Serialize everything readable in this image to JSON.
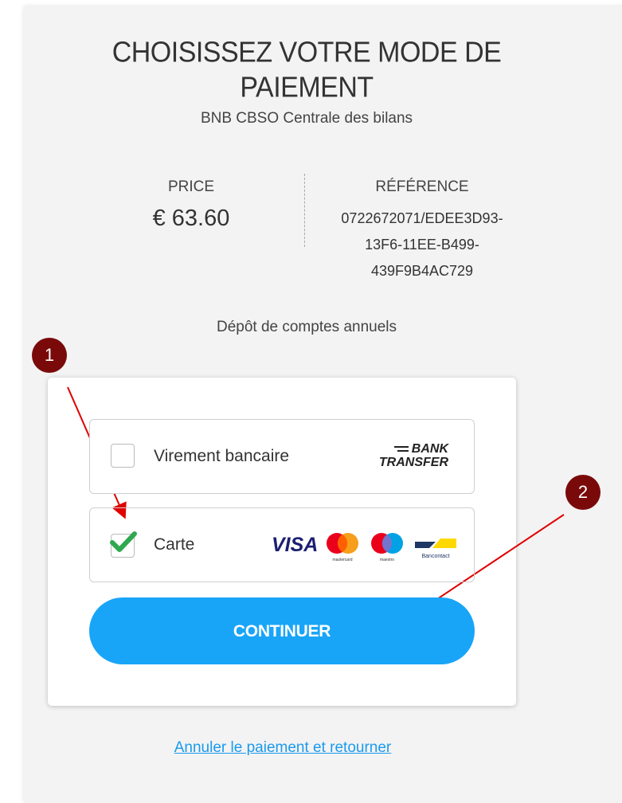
{
  "header": {
    "title_line1": "CHOISISSEZ VOTRE MODE DE",
    "title_line2": "PAIEMENT",
    "subtitle": "BNB CBSO Centrale des bilans"
  },
  "summary": {
    "price_label": "PRICE",
    "price_value": "€ 63.60",
    "reference_label": "RÉFÉRENCE",
    "reference_line1": "0722672071/EDEE3D93-",
    "reference_line2": "13F6-11EE-B499-",
    "reference_line3": "439F9B4AC729",
    "description": "Dépôt de comptes annuels"
  },
  "payment": {
    "options": [
      {
        "label": "Virement bancaire",
        "checked": false,
        "logo_line1": "BANK",
        "logo_line2": "TRANSFER"
      },
      {
        "label": "Carte",
        "checked": true,
        "logos": [
          "VISA",
          "mastercard",
          "maestro",
          "Bancontact"
        ]
      }
    ],
    "continue_label": "CONTINUER"
  },
  "footer": {
    "cancel_label": "Annuler le paiement et retourner"
  },
  "annotations": {
    "marker1": "1",
    "marker2": "2"
  },
  "colors": {
    "accent": "#18a5f8",
    "highlight": "#fbff00",
    "check": "#2fa84f",
    "marker": "#7a0a0a",
    "arrow": "#e00000"
  }
}
